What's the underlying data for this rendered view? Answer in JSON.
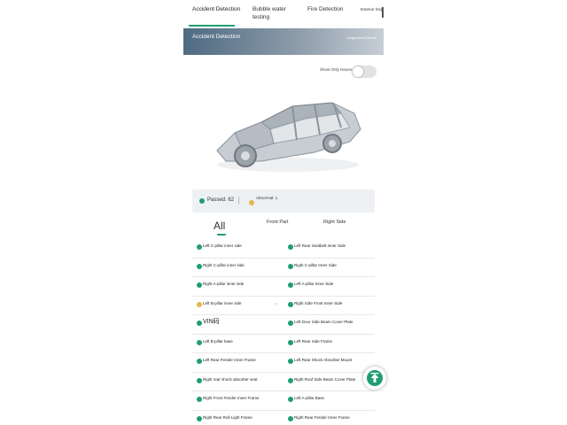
{
  "tabs": [
    "Accident Detection",
    "Bubble water testing",
    "Fire Detection",
    "Exterior Insp"
  ],
  "banner": {
    "title": "Accident Detection",
    "subtitle": "Judgement Criteria"
  },
  "toggle": {
    "label": "Show Only Issues",
    "state": "off"
  },
  "summary": {
    "passed": "Passed: 62",
    "abnormal": "Abnormal: 1"
  },
  "filters": {
    "all": "All",
    "front": "Front Part",
    "right": "Right Side"
  },
  "items": [
    {
      "left": {
        "label": "Left C-pillar inner side",
        "status": "pass"
      },
      "right": {
        "label": "Left Rear Seatbelt Inner Side",
        "status": "pass"
      }
    },
    {
      "left": {
        "label": "Right C-pillar inner side",
        "status": "pass"
      },
      "right": {
        "label": "Right C-pillar Inner Side",
        "status": "pass"
      }
    },
    {
      "left": {
        "label": "Right A-pillar inner side",
        "status": "pass"
      },
      "right": {
        "label": "Left A-pillar Inner Side",
        "status": "pass"
      }
    },
    {
      "left": {
        "label": "Left B-pillar inner side",
        "status": "warn"
      },
      "right": {
        "label": "Right Side Front Inner Side",
        "status": "pass"
      }
    },
    {
      "left": {
        "label": "VIN码",
        "status": "pass"
      },
      "right": {
        "label": "Left Door Side Beam Cover Plate",
        "status": "pass"
      }
    },
    {
      "left": {
        "label": "Left B-pillar base",
        "status": "pass"
      },
      "right": {
        "label": "Left Rear Side Frame",
        "status": "pass"
      }
    },
    {
      "left": {
        "label": "Left Rear Fender Inner Frame",
        "status": "pass"
      },
      "right": {
        "label": "Left Rear Shock Absorber Mount",
        "status": "pass"
      }
    },
    {
      "left": {
        "label": "Right rear shock absorber seat",
        "status": "pass"
      },
      "right": {
        "label": "Right Roof Side Beam Cover Plate",
        "status": "pass"
      }
    },
    {
      "left": {
        "label": "Right Front Fender Inner Frame",
        "status": "pass"
      },
      "right": {
        "label": "Left A-pillar Base",
        "status": "pass"
      }
    },
    {
      "left": {
        "label": "Right Rear Roll Light Frame",
        "status": "pass"
      },
      "right": {
        "label": "Right Rear Fender Inner Frame",
        "status": "pass"
      }
    }
  ],
  "colors": {
    "pass": "#1f9d73",
    "warn": "#e2b84a",
    "accent": "#1f9d73"
  },
  "icons": {
    "status_pass": "check-circle-icon",
    "status_warn": "warning-circle-icon",
    "fab": "upload-arrow-icon",
    "chevron": "chevron-right-icon"
  }
}
